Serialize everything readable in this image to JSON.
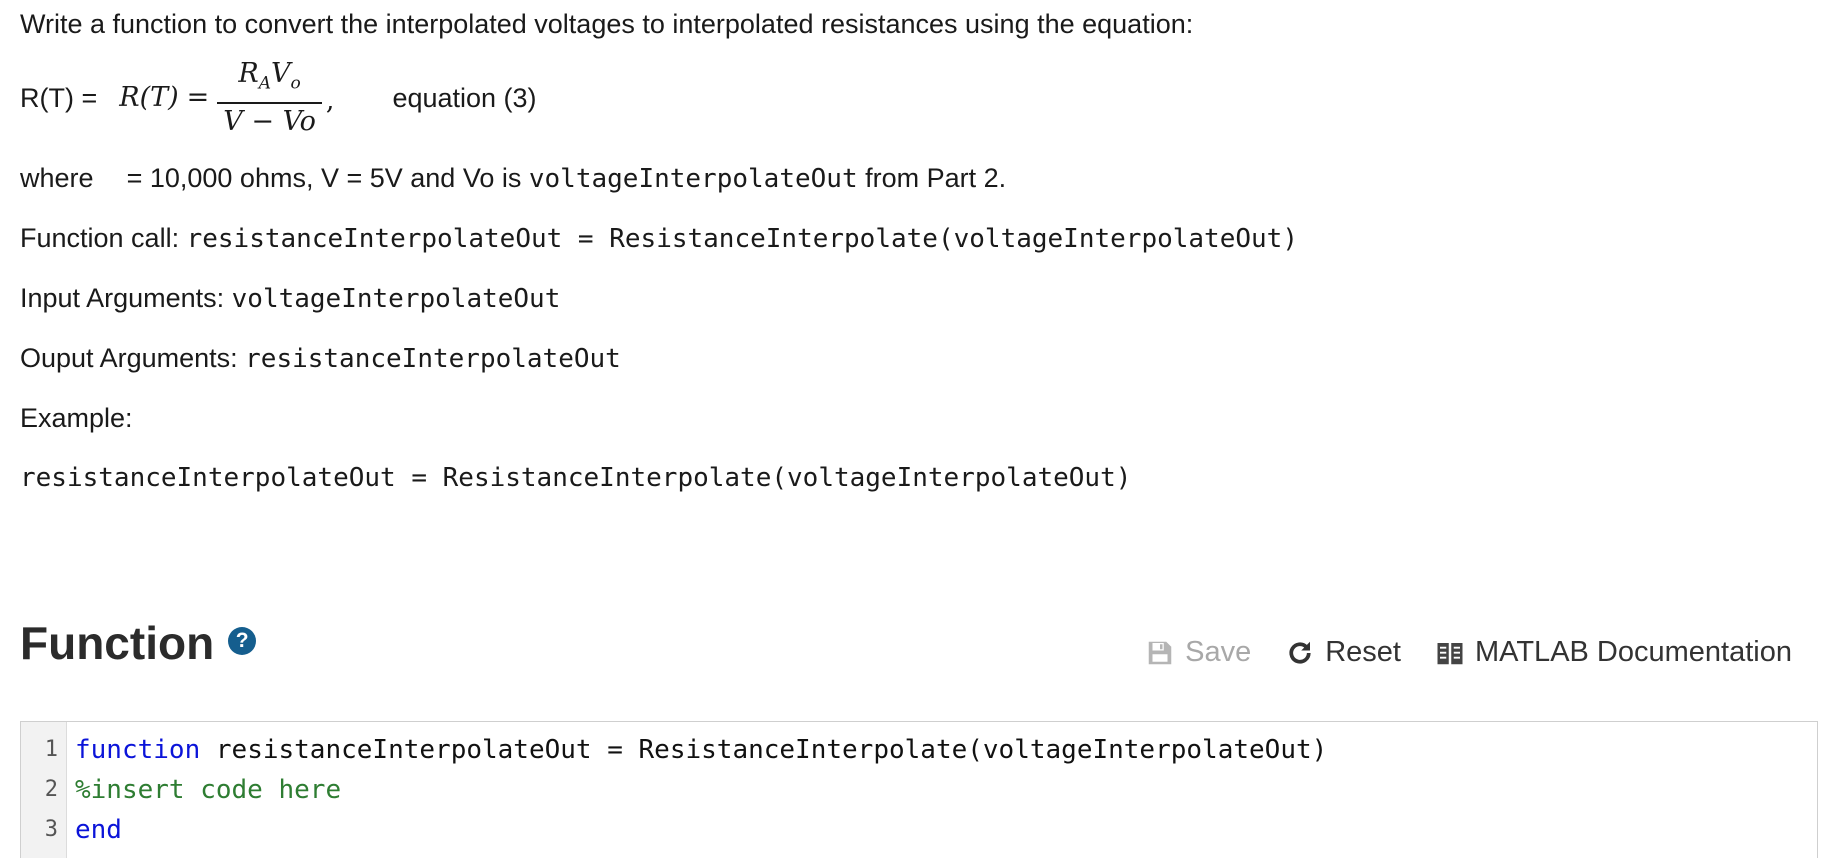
{
  "prompt": {
    "intro": "Write a function to convert the interpolated voltages to interpolated resistances using the equation:",
    "equation": {
      "text_label": "R(T) =",
      "lhs": "R(T)",
      "equals": "=",
      "numerator_R": "R",
      "numerator_R_sub": "A",
      "numerator_V": "V",
      "numerator_V_sub": "o",
      "denominator": "V − Vo",
      "comma": ",",
      "label": "equation (3)"
    },
    "where_line": {
      "prefix": "where",
      "values": "= 10,000 ohms,  V = 5V and Vo is",
      "var": "voltageInterpolateOut",
      "suffix": "from Part 2."
    },
    "function_call": {
      "label": "Function call:",
      "code": "resistanceInterpolateOut = ResistanceInterpolate(voltageInterpolateOut)"
    },
    "input_args": {
      "label": "Input Arguments:",
      "code": "voltageInterpolateOut"
    },
    "output_args": {
      "label": "Ouput Arguments:",
      "code": "resistanceInterpolateOut"
    },
    "example": {
      "label": "Example:",
      "code": "resistanceInterpolateOut = ResistanceInterpolate(voltageInterpolateOut)"
    }
  },
  "function_section": {
    "title": "Function",
    "help_icon": "question-circle-icon",
    "help_glyph": "?",
    "toolbar": {
      "save_label": "Save",
      "save_icon": "floppy-disk-icon",
      "reset_label": "Reset",
      "reset_icon": "reload-icon",
      "doc_label": "MATLAB Documentation",
      "doc_icon": "book-icon"
    }
  },
  "editor": {
    "lines": [
      {
        "number": "1",
        "keyword": "function",
        "rest": " resistanceInterpolateOut = ResistanceInterpolate(voltageInterpolateOut)"
      },
      {
        "number": "2",
        "comment": "%insert code here"
      },
      {
        "number": "3",
        "keyword": "end"
      }
    ],
    "colors": {
      "keyword": "#0b14d9",
      "comment": "#2e7d32"
    }
  }
}
